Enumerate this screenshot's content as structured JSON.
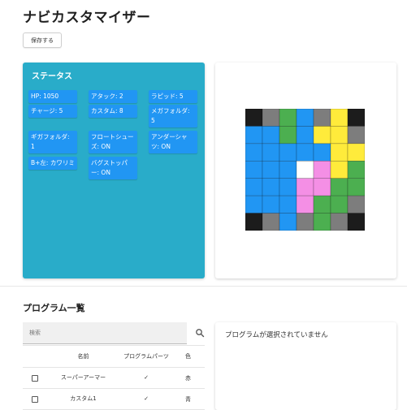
{
  "page": {
    "title": "ナビカスタマイザー"
  },
  "toolbar": {
    "save_label": "保存する"
  },
  "status": {
    "title": "ステータス",
    "chips": [
      {
        "text": "HP: 1050"
      },
      {
        "text": "アタック: 2"
      },
      {
        "text": "ラピッド: 5"
      },
      {
        "text": "チャージ: 5"
      },
      {
        "text": "カスタム: 8"
      },
      {
        "text": "メガフォルダ: 5"
      },
      {
        "text": "ギガフォルダ: 1"
      },
      {
        "text": "フロートシューズ: ON"
      },
      {
        "text": "アンダーシャツ: ON"
      },
      {
        "text": "B+左: カワリミ"
      },
      {
        "text": "バグストッパー: ON"
      }
    ]
  },
  "grid": {
    "colors": {
      "dark": "#1c1c1c",
      "gray": "#7d7d7d",
      "empty": "#ffffff",
      "blue": "#2196f3",
      "green": "#4caf50",
      "yellow": "#ffeb3b",
      "pink": "#f48fe5"
    },
    "cells": [
      [
        "dark",
        "gray",
        "green",
        "blue",
        "gray",
        "yellow",
        "dark"
      ],
      [
        "blue",
        "blue",
        "green",
        "blue",
        "yellow",
        "yellow",
        "gray"
      ],
      [
        "blue",
        "blue",
        "blue",
        "blue",
        "blue",
        "yellow",
        "yellow"
      ],
      [
        "blue",
        "blue",
        "blue",
        "empty",
        "pink",
        "yellow",
        "green"
      ],
      [
        "blue",
        "blue",
        "blue",
        "pink",
        "pink",
        "green",
        "green"
      ],
      [
        "blue",
        "blue",
        "blue",
        "pink",
        "green",
        "green",
        "gray"
      ],
      [
        "dark",
        "gray",
        "blue",
        "gray",
        "green",
        "gray",
        "dark"
      ]
    ]
  },
  "programs": {
    "title": "プログラム一覧",
    "search_placeholder": "検索",
    "columns": {
      "name": "名前",
      "part": "プログラムパーツ",
      "color": "色"
    },
    "rows": [
      {
        "name": "スーパーアーマー",
        "part": "✓",
        "color": "赤"
      },
      {
        "name": "カスタム1",
        "part": "✓",
        "color": "青"
      }
    ]
  },
  "detail": {
    "empty_text": "プログラムが選択されていません"
  }
}
